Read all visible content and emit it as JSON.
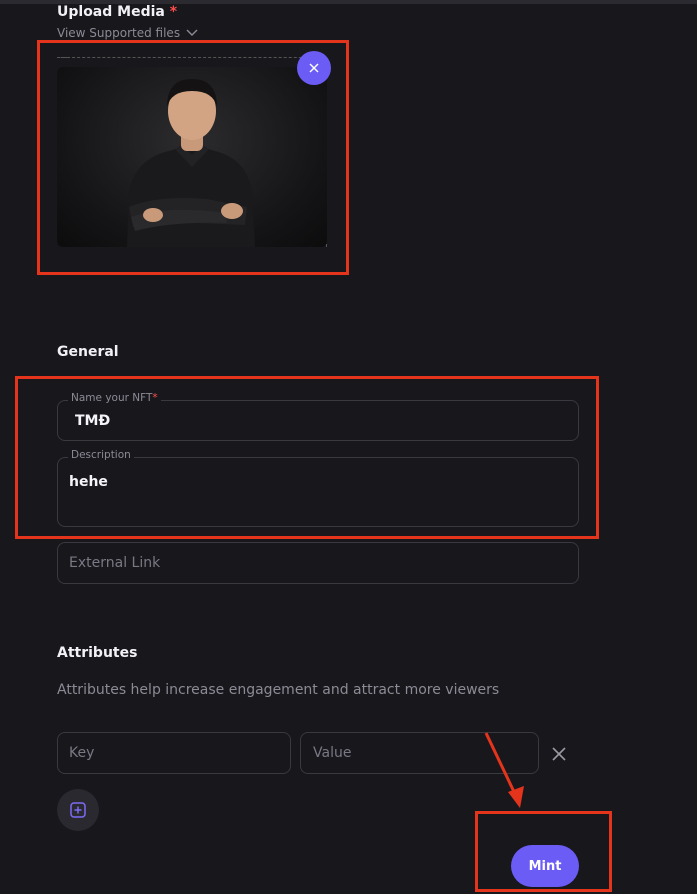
{
  "upload": {
    "title": "Upload Media",
    "required_mark": "*",
    "supported_link": "View Supported files"
  },
  "general": {
    "title": "General",
    "name_label": "Name your NFT",
    "name_required": "*",
    "name_value": "TMĐ",
    "description_label": "Description",
    "description_value": "hehe",
    "external_link_placeholder": "External Link"
  },
  "attributes": {
    "title": "Attributes",
    "help_text": "Attributes help increase engagement and attract more viewers",
    "key_placeholder": "Key",
    "value_placeholder": "Value"
  },
  "actions": {
    "mint_label": "Mint"
  },
  "colors": {
    "accent": "#6b5cf6",
    "annotation": "#e5341c",
    "background": "#18171c"
  },
  "icons": [
    "chevron-down-icon",
    "close-icon",
    "x-icon",
    "plus-square-icon"
  ]
}
